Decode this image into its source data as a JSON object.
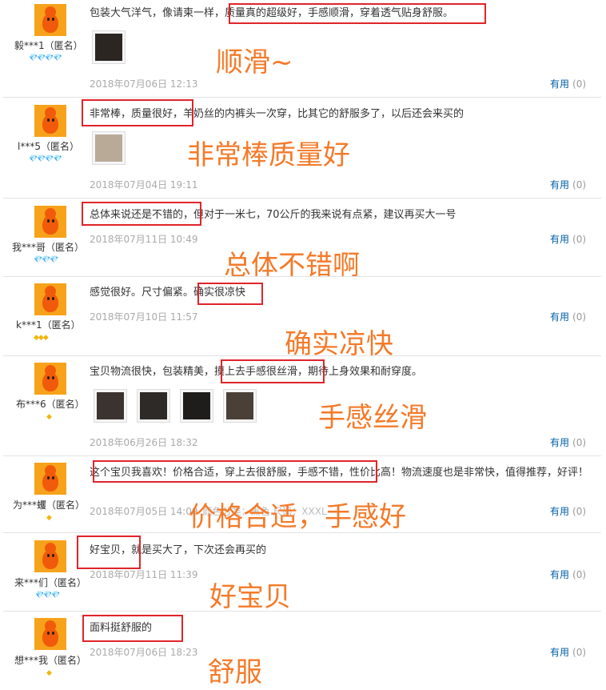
{
  "reviews": [
    {
      "user": "毅***1（匿名）",
      "level": "💎💎💎💎",
      "text": "包装大气洋气，像请柬一样，质量真的超级好，手感顺滑，穿着透气贴身舒服。",
      "date": "2018年07月06日 12:13",
      "useful_label": "有用",
      "useful_count": "(0)",
      "annotation": "顺滑~"
    },
    {
      "user": "l***5（匿名）",
      "level": "💎💎💎💎",
      "text": "非常棒，质量很好，羊奶丝的内裤头一次穿，比其它的舒服多了，以后还会来买的",
      "date": "2018年07月04日 19:11",
      "useful_label": "有用",
      "useful_count": "(0)",
      "annotation": "非常棒质量好"
    },
    {
      "user": "我***哥（匿名）",
      "level": "💎💎💎",
      "text": "总体来说还是不错的，但对于一米七，70公斤的我来说有点紧，建议再买大一号",
      "date": "2018年07月11日 10:49",
      "useful_label": "有用",
      "useful_count": "(0)",
      "annotation": "总体不错啊"
    },
    {
      "user": "k***1（匿名）",
      "level": "◆◆◆",
      "text": "感觉很好。尺寸偏紧。确实很凉快",
      "date": "2018年07月10日 11:57",
      "useful_label": "有用",
      "useful_count": "(0)",
      "annotation": "确实凉快"
    },
    {
      "user": "布***6（匿名）",
      "level": "◆",
      "text": "宝贝物流很快，包装精美，摸上去手感很丝滑，期待上身效果和耐穿度。",
      "date": "2018年06月26日 18:32",
      "useful_label": "有用",
      "useful_count": "(0)",
      "annotation": "手感丝滑"
    },
    {
      "user": "为***蠼（匿名）",
      "level": "◆",
      "text": "这个宝贝我喜欢！价格合适，穿上去很舒服，手感不错，性价比高！物流速度也是非常快，值得推荐，好评！",
      "date": "2018年07月05日 14:09",
      "date_extra": "颜色分类：黑色  尺码：XXXL",
      "useful_label": "有用",
      "useful_count": "(0)",
      "annotation": "价格合适，手感好"
    },
    {
      "user": "来***们（匿名）",
      "level": "💎💎💎",
      "text": "好宝贝，就是买大了，下次还会再买的",
      "date": "2018年07月11日 11:39",
      "useful_label": "有用",
      "useful_count": "(0)",
      "annotation": "好宝贝"
    },
    {
      "user": "想***我（匿名）",
      "level": "◆",
      "text": "面料挺舒服的",
      "date": "2018年07月06日 18:23",
      "useful_label": "有用",
      "useful_count": "(0)",
      "annotation": "舒服"
    }
  ],
  "colors": {
    "annotation": "#f47a29",
    "highlight_box": "#e0242a",
    "useful_link": "#005ea7",
    "avatar": "#f7a21b"
  }
}
